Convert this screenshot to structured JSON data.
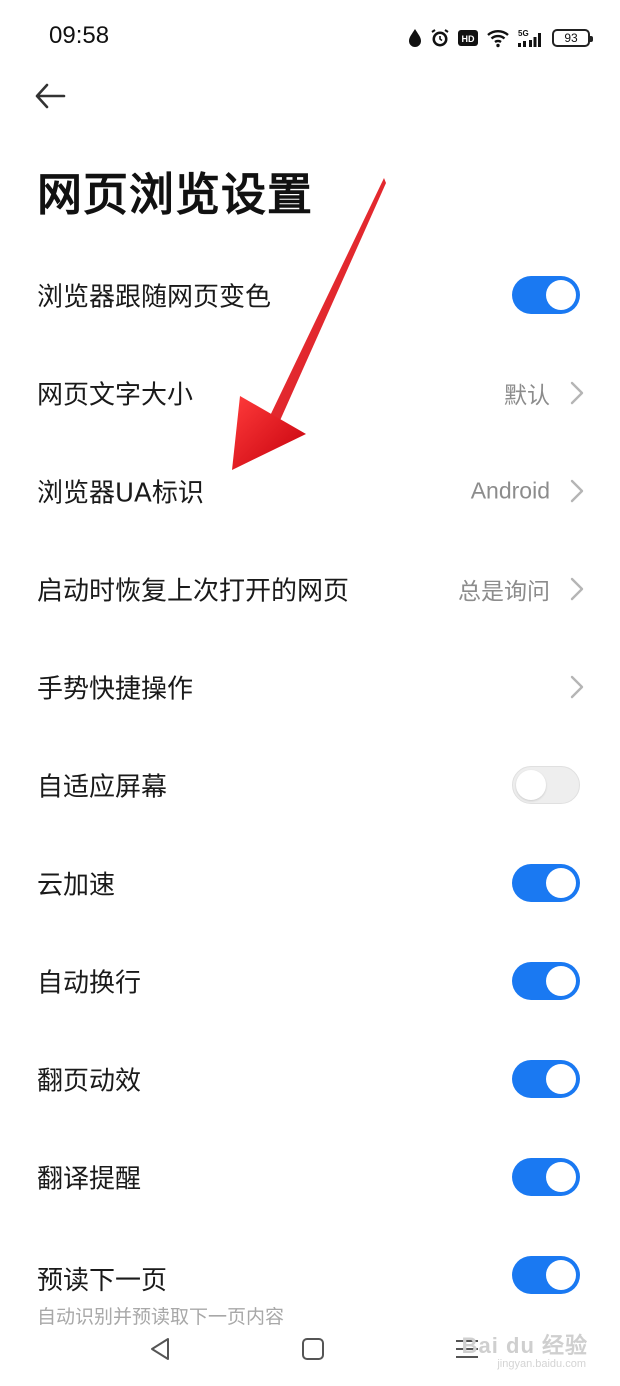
{
  "status_bar": {
    "time": "09:58",
    "battery": "93",
    "network": "5G"
  },
  "header": {
    "title": "网页浏览设置"
  },
  "settings": [
    {
      "label": "浏览器跟随网页变色",
      "type": "toggle",
      "on": true
    },
    {
      "label": "网页文字大小",
      "type": "link",
      "value": "默认"
    },
    {
      "label": "浏览器UA标识",
      "type": "link",
      "value": "Android"
    },
    {
      "label": "启动时恢复上次打开的网页",
      "type": "link",
      "value": "总是询问"
    },
    {
      "label": "手势快捷操作",
      "type": "link",
      "value": ""
    },
    {
      "label": "自适应屏幕",
      "type": "toggle",
      "on": false
    },
    {
      "label": "云加速",
      "type": "toggle",
      "on": true
    },
    {
      "label": "自动换行",
      "type": "toggle",
      "on": true
    },
    {
      "label": "翻页动效",
      "type": "toggle",
      "on": true
    },
    {
      "label": "翻译提醒",
      "type": "toggle",
      "on": true
    },
    {
      "label": "预读下一页",
      "sublabel": "自动识别并预读取下一页内容",
      "type": "toggle",
      "on": true
    }
  ],
  "watermark": {
    "text": "Bai du 经验",
    "sub": "jingyan.baidu.com"
  },
  "colors": {
    "accent": "#1a79f2",
    "annotation_arrow": "#e8101b"
  },
  "icons": {
    "back": "arrow-left-icon",
    "nav_back": "triangle-back-icon",
    "nav_home": "square-home-icon",
    "nav_menu": "menu-lines-icon"
  }
}
